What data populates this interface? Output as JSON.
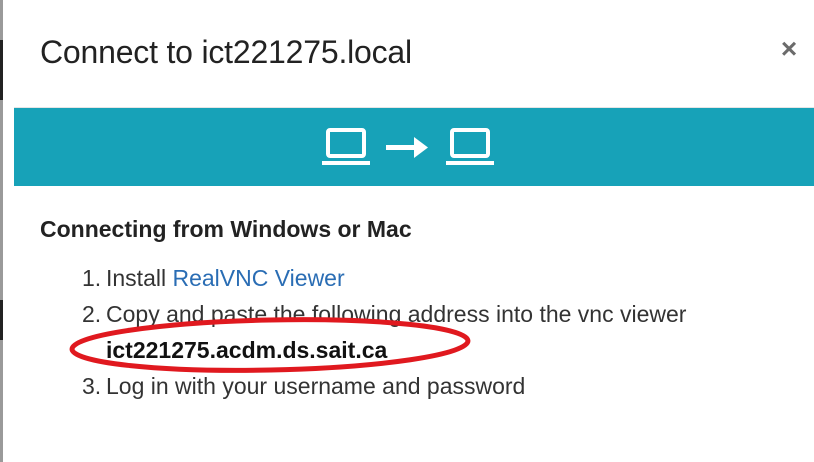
{
  "modal": {
    "title": "Connect to ict221275.local",
    "close_label": "×"
  },
  "banner": {
    "icons": [
      "laptop-icon",
      "arrow-right-icon",
      "laptop-icon"
    ],
    "color": "#17a2b8"
  },
  "body": {
    "heading": "Connecting from Windows or Mac",
    "steps": [
      {
        "number": "1.",
        "text": "Install ",
        "link_text": "RealVNC Viewer"
      },
      {
        "number": "2.",
        "text": "Copy and paste the following address into the vnc viewer",
        "address": "ict221275.acdm.ds.sait.ca"
      },
      {
        "number": "3.",
        "text": "Log in with your username and password"
      }
    ]
  },
  "annotation": {
    "shape": "ellipse",
    "color": "#e0191f",
    "target": "address"
  }
}
